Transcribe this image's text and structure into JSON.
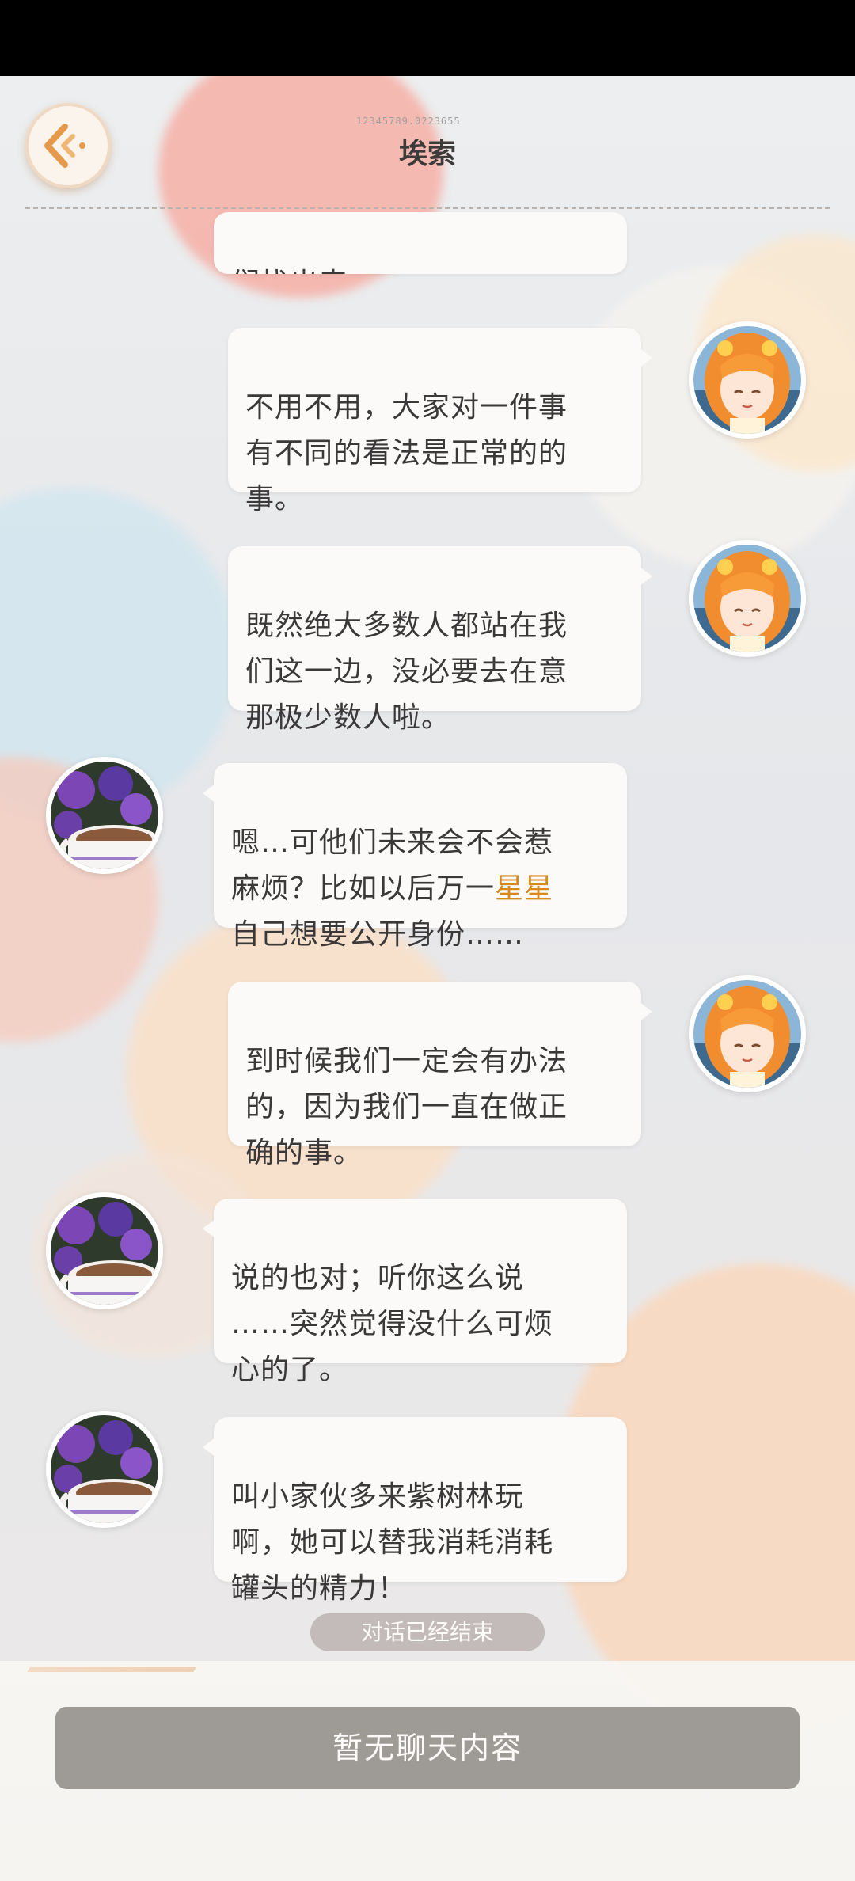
{
  "header": {
    "title": "埃索",
    "id_text": "12345789.0223655"
  },
  "messages": [
    {
      "side": "left",
      "speaker": "player",
      "text": "们找出来……"
    },
    {
      "side": "right",
      "speaker": "girl",
      "text": "不用不用，大家对一件事\n有不同的看法是正常的的\n事。"
    },
    {
      "side": "right",
      "speaker": "girl",
      "text": "既然绝大多数人都站在我\n们这一边，没必要去在意\n那极少数人啦。"
    },
    {
      "side": "left",
      "speaker": "player",
      "text_before": "嗯…可他们未来会不会惹\n麻烦？比如以后万一",
      "highlight": "星星",
      "text_after": "\n自己想要公开身份……"
    },
    {
      "side": "right",
      "speaker": "girl",
      "text": "到时候我们一定会有办法\n的，因为我们一直在做正\n确的事。"
    },
    {
      "side": "left",
      "speaker": "player",
      "text": "说的也对；听你这么说\n……突然觉得没什么可烦\n心的了。"
    },
    {
      "side": "left",
      "speaker": "player",
      "text": "叫小家伙多来紫树林玩\n啊，她可以替我消耗消耗\n罐头的精力！"
    }
  ],
  "status": {
    "ended_label": "对话已经结束"
  },
  "footer": {
    "empty_label": "暂无聊天内容"
  },
  "colors": {
    "highlight": "#d9881e",
    "bubble": "#fbfaf8",
    "button": "#9e9a96"
  },
  "icons": {
    "back": "back-arrow-icon",
    "girl_avatar": "orange-hair-girl-avatar",
    "player_avatar": "coffee-cup-hydrangea-avatar"
  }
}
